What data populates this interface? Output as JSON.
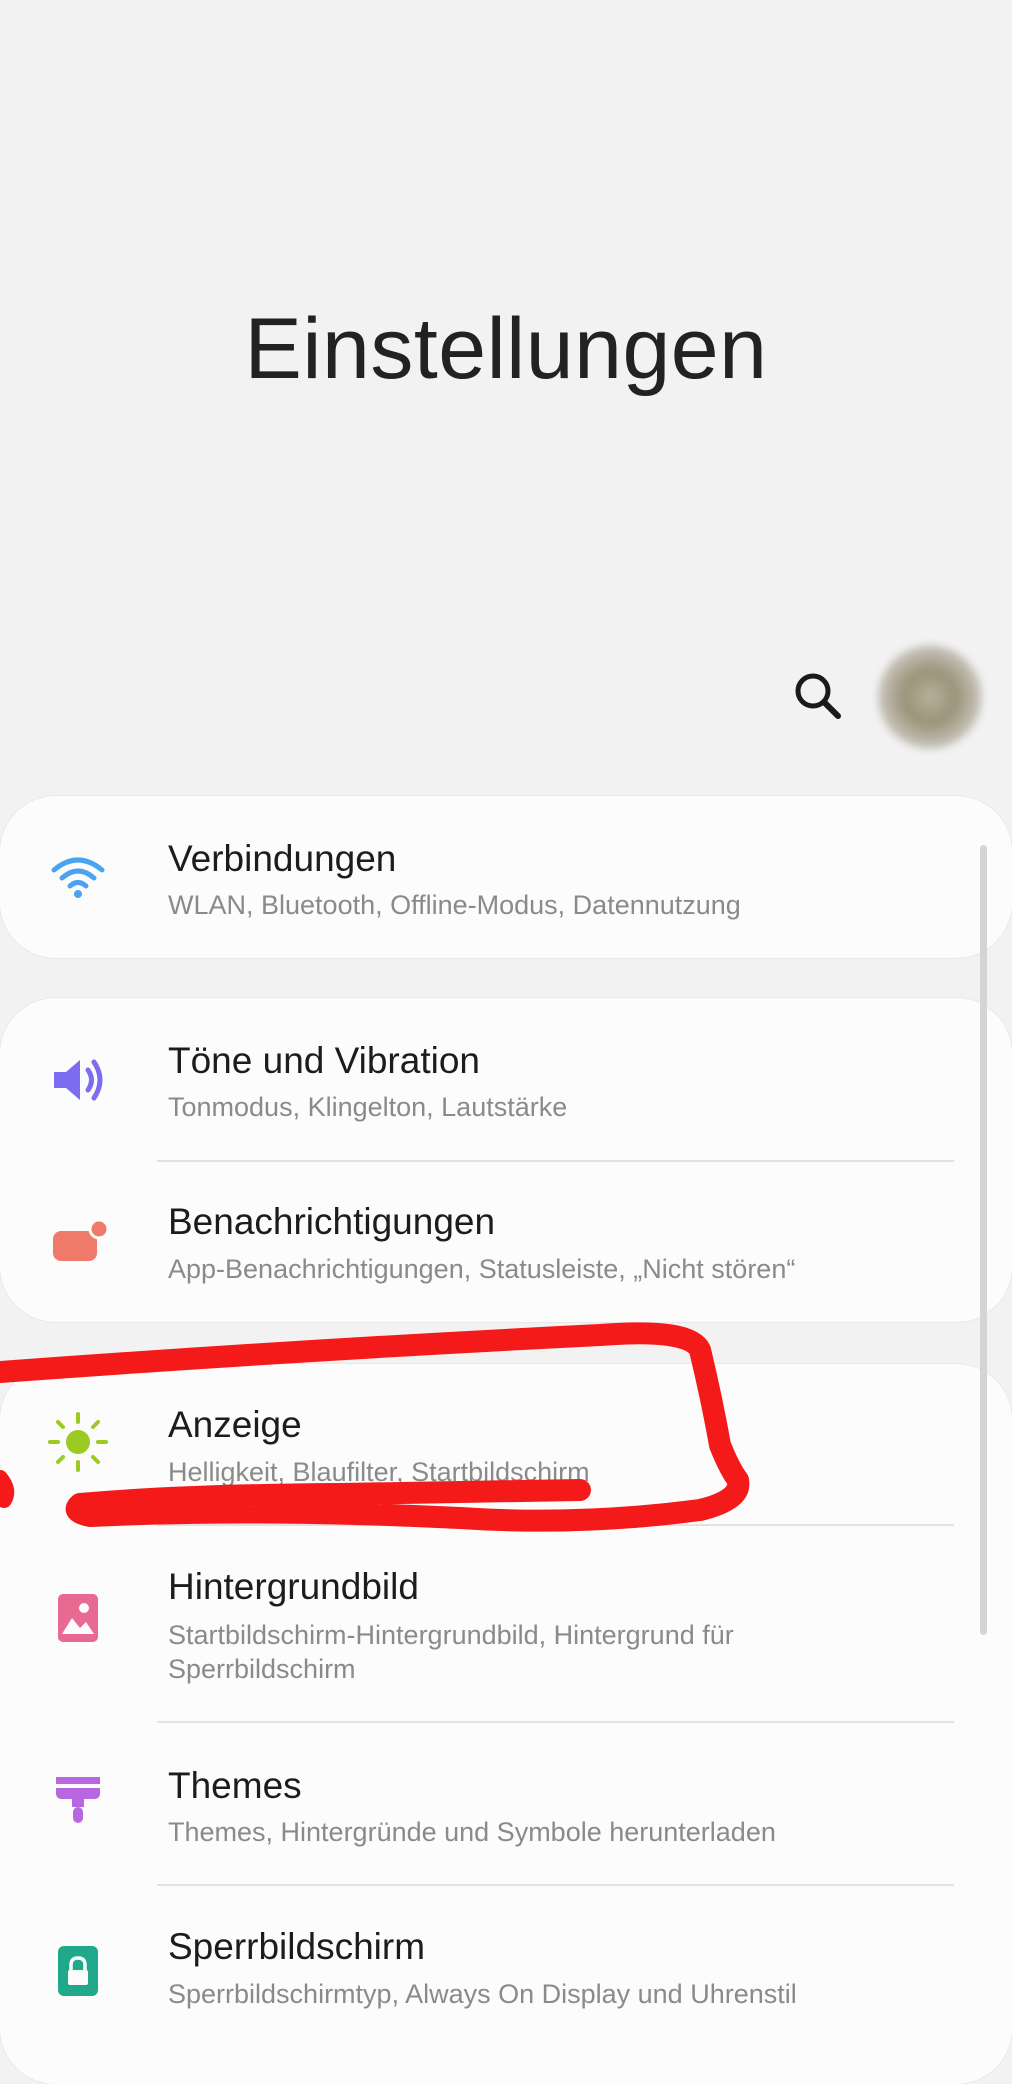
{
  "header": {
    "title": "Einstellungen"
  },
  "toolbar": {
    "search_icon": "search-icon",
    "avatar": "profile-avatar"
  },
  "colors": {
    "background": "#f2f2f2",
    "card": "#fcfcfc",
    "connections_icon": "#4aa3f0",
    "sound_icon": "#7b6cf0",
    "notifications_icon": "#ef7a6a",
    "display_icon": "#9bcb22",
    "wallpaper_icon": "#e86a92",
    "themes_icon": "#b768e0",
    "lockscreen_icon": "#1fa88a",
    "annotation": "#f41a1a"
  },
  "settings": {
    "connections": {
      "label": "Verbindungen",
      "sub": "WLAN, Bluetooth, Offline-Modus, Datennutzung",
      "icon": "wifi-icon"
    },
    "sound": {
      "label": "Töne und Vibration",
      "sub": "Tonmodus, Klingelton, Lautstärke",
      "icon": "speaker-icon"
    },
    "notifications": {
      "label": "Benachrichtigungen",
      "sub": "App-Benachrichtigungen, Statusleiste, „Nicht stören“",
      "icon": "notification-badge-icon"
    },
    "display": {
      "label": "Anzeige",
      "sub": "Helligkeit, Blaufilter, Startbildschirm",
      "icon": "sun-icon"
    },
    "wallpaper": {
      "label": "Hintergrundbild",
      "sub": "Startbildschirm-Hintergrundbild, Hintergrund für Sperrbildschirm",
      "icon": "image-icon"
    },
    "themes": {
      "label": "Themes",
      "sub": "Themes, Hintergründe und Symbole herunterladen",
      "icon": "paint-brush-icon"
    },
    "lockscreen": {
      "label": "Sperrbildschirm",
      "sub": "Sperrbildschirmtyp, Always On Display und Uhrenstil",
      "icon": "lock-icon"
    }
  }
}
